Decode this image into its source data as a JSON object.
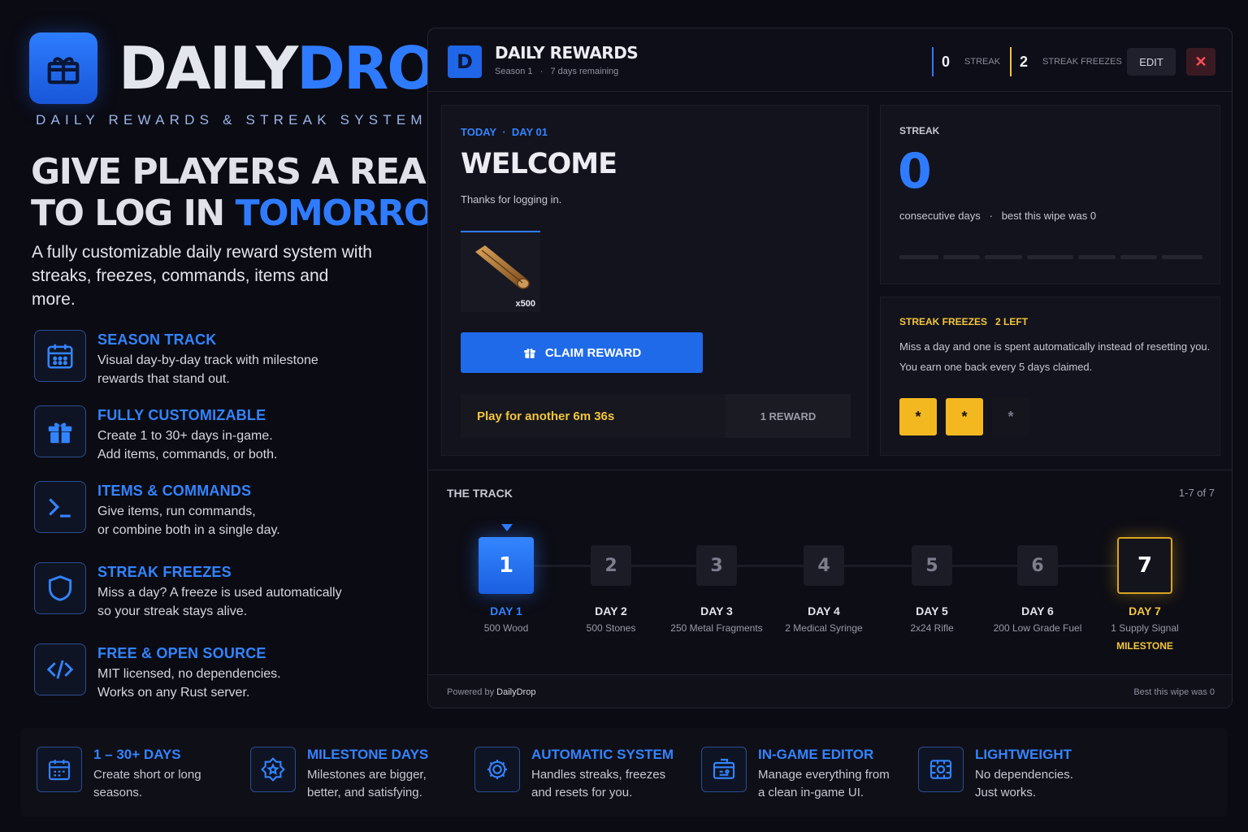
{
  "brand": {
    "name_white": "DAILY",
    "name_blue": "DROP",
    "tagline": "DAILY  REWARDS & STREAK SYSTEM"
  },
  "hero": {
    "line1": "GIVE PLAYERS A REASON",
    "line2a": "TO LOG IN ",
    "line2b": "TOMORROW.",
    "lede": "A fully customizable daily reward system with streaks, freezes, commands, items and more."
  },
  "features": [
    {
      "icon": "calendar-icon",
      "title": "SEASON TRACK",
      "desc": "Visual day-by-day track with milestone\nrewards that stand out."
    },
    {
      "icon": "gift-icon",
      "title": "FULLY CUSTOMIZABLE",
      "desc": "Create 1 to 30+ days in-game.\nAdd items, commands, or both."
    },
    {
      "icon": "terminal-icon",
      "title": "ITEMS & COMMANDS",
      "desc": "Give items, run commands,\nor combine both in a single day."
    },
    {
      "icon": "shield-icon",
      "title": "STREAK FREEZES",
      "desc": "Miss a day? A freeze is used automatically\nso your streak stays alive."
    },
    {
      "icon": "code-icon",
      "title": "FREE & OPEN SOURCE",
      "desc": "MIT licensed, no dependencies.\nWorks on any Rust server."
    }
  ],
  "panel": {
    "badge": "D",
    "title": "DAILY REWARDS",
    "season": "Season 1",
    "sep": "·",
    "remaining": "7 days remaining",
    "streak_count": "0",
    "streak_label": "STREAK",
    "freeze_count": "2",
    "freeze_label": "STREAK FREEZES",
    "edit": "EDIT",
    "close": "✕"
  },
  "today": {
    "label": "TODAY",
    "dot": "·",
    "day": "DAY 01",
    "title": "WELCOME",
    "message": "Thanks for logging in.",
    "item_qty": "x500",
    "claim": "CLAIM REWARD",
    "play_timer": "Play for another 6m 36s",
    "reward_count": "1 REWARD"
  },
  "streak": {
    "label": "STREAK",
    "value": "0",
    "sub1": "consecutive days",
    "dot": "·",
    "sub2": "best this wipe was 0",
    "segments": 7
  },
  "freezes": {
    "label": "STREAK FREEZES",
    "left": "2 LEFT",
    "line1": "Miss a day and one is spent automatically instead of resetting you.",
    "line2": "You earn one back every 5 days claimed.",
    "slots": [
      {
        "symbol": "*",
        "active": true
      },
      {
        "symbol": "*",
        "active": true
      },
      {
        "symbol": "*",
        "active": false
      }
    ]
  },
  "track": {
    "title": "THE TRACK",
    "range": "1-7 of 7",
    "days": [
      {
        "num": "1",
        "label": "DAY 1",
        "reward": "500 Wood",
        "state": "current"
      },
      {
        "num": "2",
        "label": "DAY 2",
        "reward": "500 Stones",
        "state": "locked"
      },
      {
        "num": "3",
        "label": "DAY 3",
        "reward": "250 Metal Fragments",
        "state": "locked"
      },
      {
        "num": "4",
        "label": "DAY 4",
        "reward": "2 Medical Syringe",
        "state": "locked"
      },
      {
        "num": "5",
        "label": "DAY 5",
        "reward": "2x24 Rifle",
        "state": "locked"
      },
      {
        "num": "6",
        "label": "DAY 6",
        "reward": "200 Low Grade Fuel",
        "state": "locked"
      },
      {
        "num": "7",
        "label": "DAY 7",
        "reward": "1 Supply Signal",
        "state": "milestone",
        "tag": "MILESTONE"
      }
    ]
  },
  "footer": {
    "powered_prefix": "Powered by ",
    "powered_brand": "DailyDrop",
    "best": "Best this wipe was 0"
  },
  "bottom": [
    {
      "icon": "calendar-grid-icon",
      "title": "1 – 30+ DAYS",
      "desc": "Create short or long\nseasons."
    },
    {
      "icon": "milestone-badge-icon",
      "title": "MILESTONE DAYS",
      "desc": "Milestones are bigger,\nbetter, and satisfying."
    },
    {
      "icon": "gear-cycle-icon",
      "title": "AUTOMATIC SYSTEM",
      "desc": "Handles streaks, freezes\nand resets for you."
    },
    {
      "icon": "editor-icon",
      "title": "IN-GAME EDITOR",
      "desc": "Manage everything from\na clean in-game UI."
    },
    {
      "icon": "layers-icon",
      "title": "LIGHTWEIGHT",
      "desc": "No dependencies.\nJust works."
    }
  ],
  "colors": {
    "accent": "#2f7bff",
    "gold": "#f3c63a",
    "danger": "#ff4d5a",
    "bg": "#0b0b13"
  }
}
